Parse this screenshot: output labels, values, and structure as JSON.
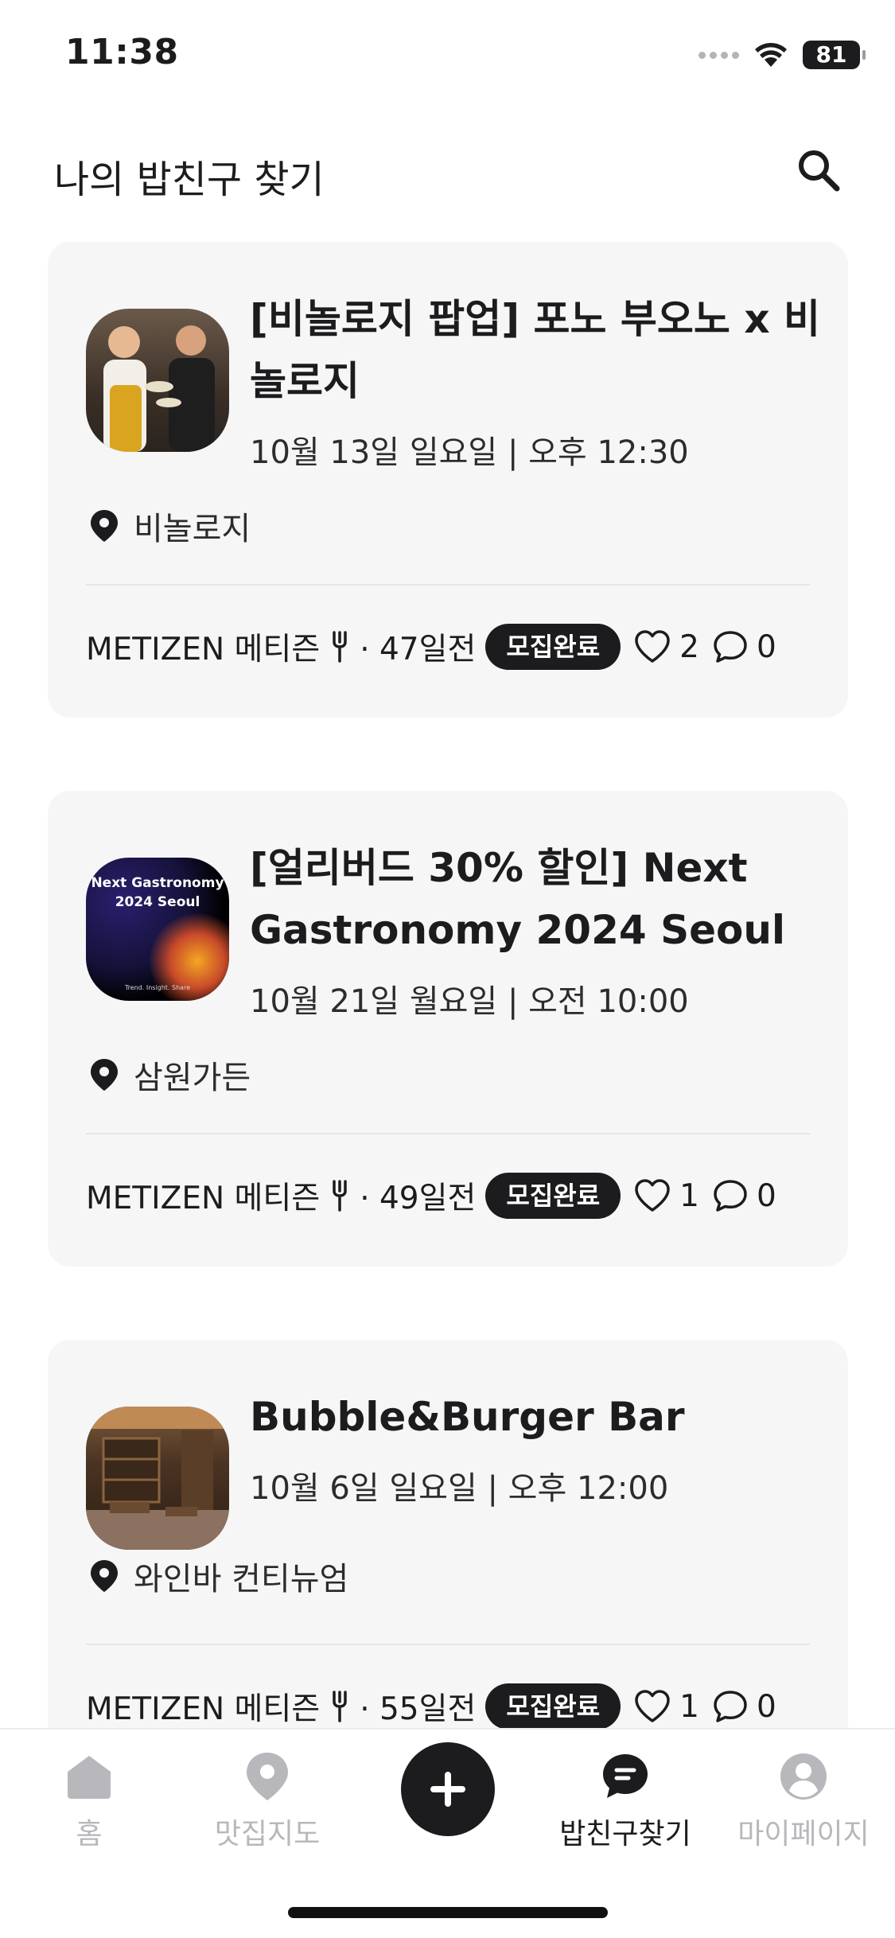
{
  "status_bar": {
    "time": "11:38",
    "battery": "81"
  },
  "header": {
    "title": "나의 밥친구 찾기"
  },
  "posts": [
    {
      "title": "[비놀로지 팝업] 포노 부오노 x 비놀로지",
      "date": "10월 13일 일요일 | 오후 12:30",
      "location": "비놀로지",
      "author": "METIZEN 메티즌",
      "time_ago": "· 47일전",
      "status": "모집완료",
      "likes": "2",
      "comments": "0"
    },
    {
      "title": "[얼리버드 30% 할인] Next Gastronomy 2024 Seoul",
      "date": "10월 21일 월요일 | 오전 10:00",
      "location": "삼원가든",
      "author": "METIZEN 메티즌",
      "time_ago": "· 49일전",
      "status": "모집완료",
      "likes": "1",
      "comments": "0",
      "thumb_title": "Next Gastronomy 2024 Seoul",
      "thumb_tagline": "Trend. Insight. Share"
    },
    {
      "title": "Bubble&Burger Bar",
      "date": "10월 6일 일요일 | 오후 12:00",
      "location": "와인바 컨티뉴엄",
      "author": "METIZEN 메티즌",
      "time_ago": "· 55일전",
      "status": "모집완료",
      "likes": "1",
      "comments": "0"
    }
  ],
  "tabbar": {
    "home": "홈",
    "map": "맛집지도",
    "find": "밥친구찾기",
    "mypage": "마이페이지"
  },
  "colors": {
    "accent": "#1c1c1e",
    "card_bg": "#f6f6f7",
    "inactive": "#b8b8bc"
  }
}
